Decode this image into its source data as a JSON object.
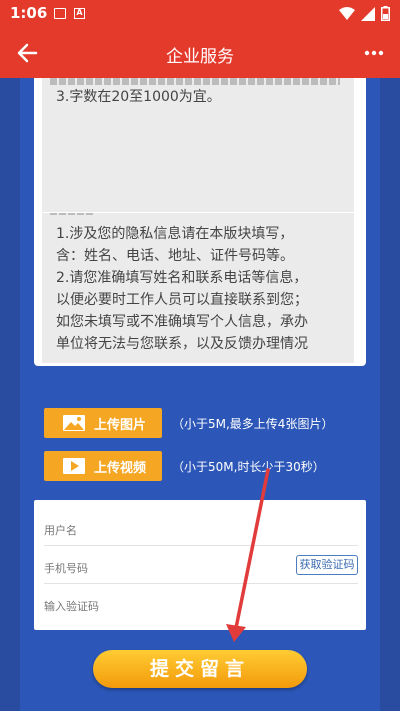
{
  "status_bar": {
    "time": "1:06"
  },
  "header": {
    "title": "企业服务"
  },
  "textarea_content": {
    "item3": "3.字数在20至1000为宜。"
  },
  "privacy_notice": {
    "lines": [
      "1.涉及您的隐私信息请在本版块填写，",
      "含：姓名、电话、地址、证件号码等。",
      "2.请您准确填写姓名和联系电话等信息，",
      "以便必要时工作人员可以直接联系到您；",
      "如您未填写或不准确填写个人信息，承办",
      "单位将无法与您联系，以及反馈办理情况"
    ]
  },
  "upload": {
    "image_label": "上传图片",
    "image_hint": "（小于5M,最多上传4张图片）",
    "video_label": "上传视频",
    "video_hint": "（小于50M,时长少于30秒）"
  },
  "form": {
    "username_placeholder": "用户名",
    "phone_placeholder": "手机号码",
    "get_code_label": "获取验证码",
    "code_placeholder": "输入验证码"
  },
  "submit_label": "提交留言",
  "colors": {
    "header": "#e33a2c",
    "page_bg": "#2a4ca0",
    "accent": "#f5a623"
  }
}
